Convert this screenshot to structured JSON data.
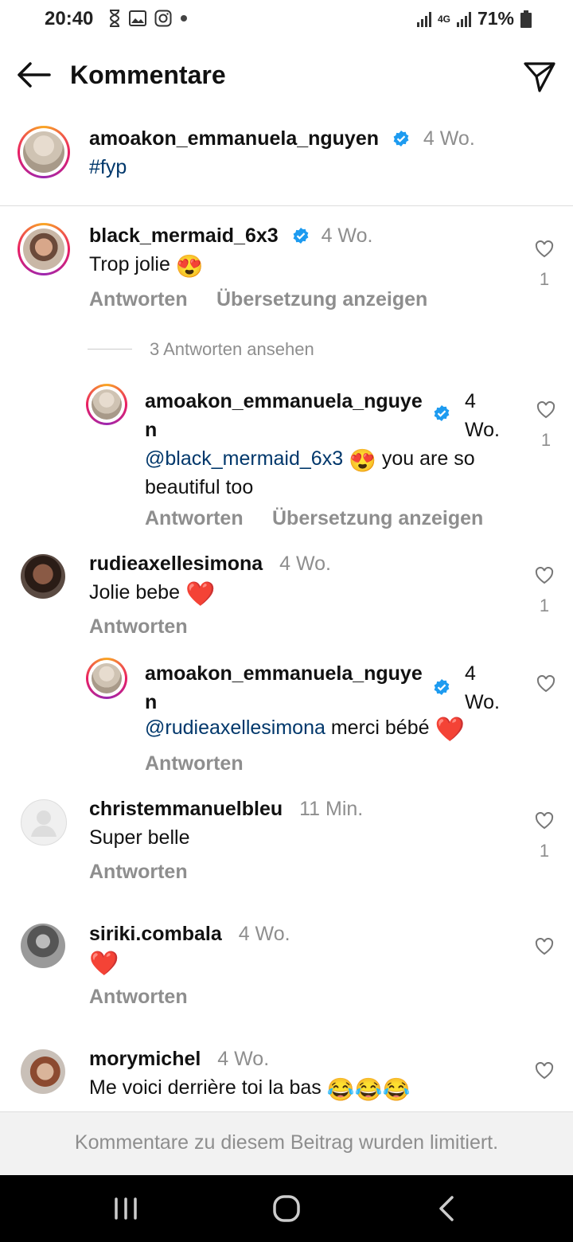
{
  "status": {
    "time": "20:40",
    "battery": "71%",
    "network": "4G"
  },
  "header": {
    "title": "Kommentare"
  },
  "caption": {
    "username": "amoakon_emmanuela_nguyen",
    "time": "4 Wo.",
    "text": "#fyp"
  },
  "comments": [
    {
      "username": "black_mermaid_6x3",
      "time": "4 Wo.",
      "text": "Trop jolie",
      "emoji": "😍",
      "likes": "1",
      "reply": "Antworten",
      "translate": "Übersetzung anzeigen"
    },
    {
      "username": "rudieaxellesimona",
      "time": "4 Wo.",
      "text": "Jolie bebe",
      "emoji": "❤️",
      "likes": "1",
      "reply": "Antworten"
    },
    {
      "username": "christemmanuelbleu",
      "time": "11 Min.",
      "text": "Super belle",
      "likes": "1",
      "reply": "Antworten"
    },
    {
      "username": "siriki.combala",
      "time": "4 Wo.",
      "emoji": "❤️",
      "reply": "Antworten"
    },
    {
      "username": "morymichel",
      "time": "4 Wo.",
      "text": "Me voici derrière toi la bas",
      "emoji": "😂😂😂"
    }
  ],
  "view_replies": "3 Antworten ansehen",
  "replies": [
    {
      "username_line1": "amoakon_emmanuela_nguye",
      "username_line2": "n",
      "time_line1": "4",
      "time_line2": "Wo.",
      "mention": "@black_mermaid_6x3",
      "emoji": "😍",
      "text_after": "you are so",
      "text_line2": "beautiful too",
      "likes": "1",
      "reply": "Antworten",
      "translate": "Übersetzung anzeigen"
    },
    {
      "username_line1": "amoakon_emmanuela_nguye",
      "username_line2": "n",
      "time_line1": "4",
      "time_line2": "Wo.",
      "mention": "@rudieaxellesimona",
      "text_after": "merci bébé",
      "emoji": "❤️",
      "reply": "Antworten"
    }
  ],
  "footer": {
    "notice": "Kommentare zu diesem Beitrag wurden limitiert."
  },
  "icons": [
    "hourglass-icon",
    "gallery-icon",
    "instagram-icon",
    "signal-icon",
    "battery-icon",
    "back-arrow-icon",
    "send-icon",
    "verified-icon",
    "heart-outline-icon",
    "recent-apps-icon",
    "home-icon",
    "back-nav-icon"
  ]
}
